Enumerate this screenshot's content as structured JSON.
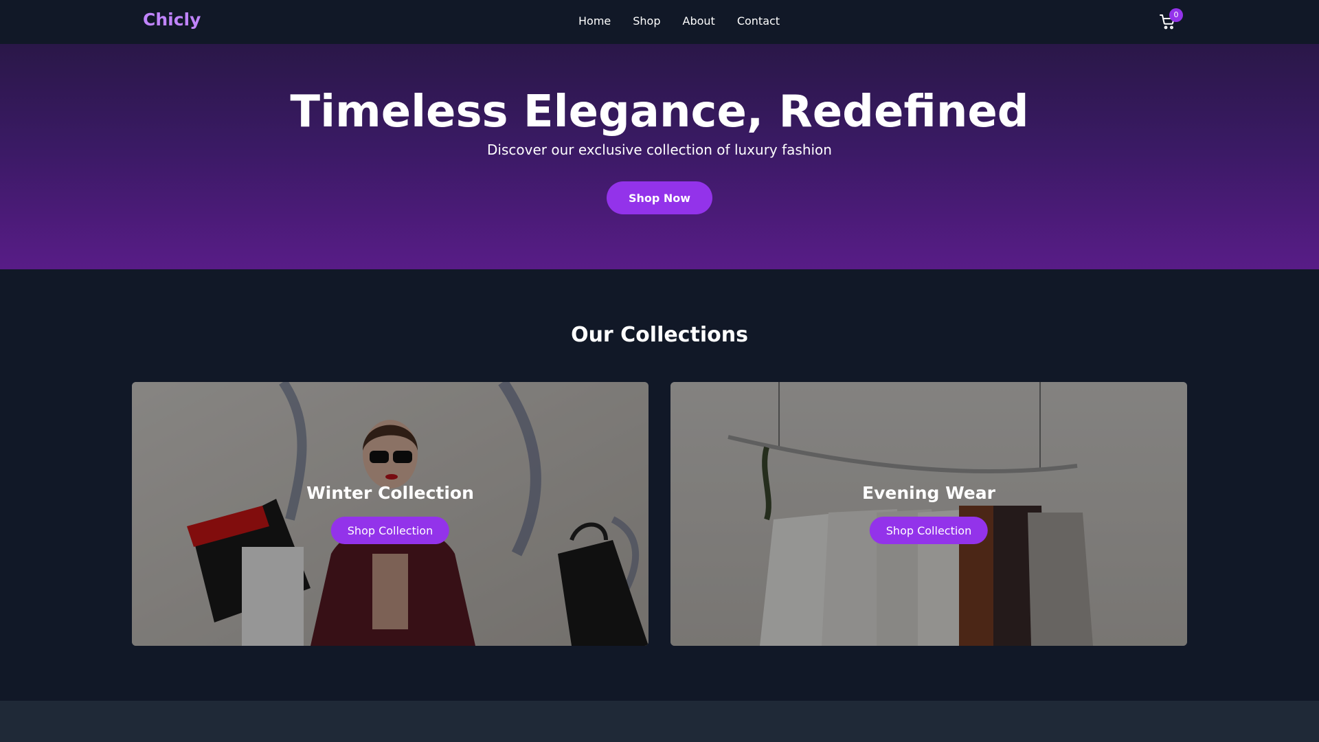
{
  "header": {
    "logo": "Chicly",
    "nav": [
      "Home",
      "Shop",
      "About",
      "Contact"
    ],
    "cart_count": "0"
  },
  "hero": {
    "title": "Timeless Elegance, Redefined",
    "subtitle": "Discover our exclusive collection of luxury fashion",
    "cta": "Shop Now"
  },
  "collections": {
    "title": "Our Collections",
    "cards": [
      {
        "title": "Winter Collection",
        "button": "Shop Collection"
      },
      {
        "title": "Evening Wear",
        "button": "Shop Collection"
      }
    ]
  },
  "colors": {
    "background": "#111827",
    "accent": "#9333ea",
    "logo": "#c084fc",
    "footer": "#1f2937"
  }
}
